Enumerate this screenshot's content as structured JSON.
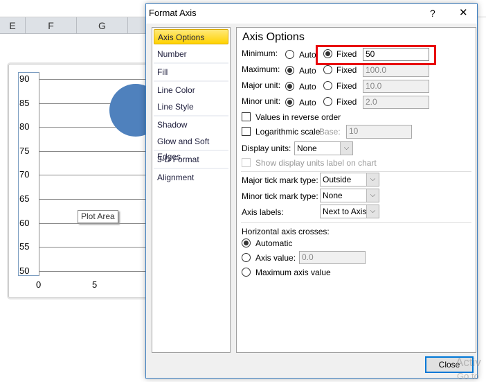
{
  "spreadsheet": {
    "columns": [
      "E",
      "F",
      "G"
    ]
  },
  "chart": {
    "y_ticks": [
      "90",
      "85",
      "80",
      "75",
      "70",
      "65",
      "60",
      "55",
      "50"
    ],
    "x_ticks": [
      "0",
      "5"
    ],
    "tooltip": "Plot Area",
    "bubble_color": "#4f81bd"
  },
  "dialog": {
    "title": "Format Axis",
    "help": "?",
    "close_x": "✕",
    "nav": [
      "Axis Options",
      "Number",
      "Fill",
      "Line Color",
      "Line Style",
      "Shadow",
      "Glow and Soft Edges",
      "3-D Format",
      "Alignment"
    ],
    "panel_title": "Axis Options",
    "rows": [
      {
        "label": "Minimum:",
        "auto": "Auto",
        "fixed": "Fixed",
        "value": "50",
        "selected": "fixed"
      },
      {
        "label": "Maximum:",
        "auto": "Auto",
        "fixed": "Fixed",
        "value": "100.0",
        "selected": "auto"
      },
      {
        "label": "Major unit:",
        "auto": "Auto",
        "fixed": "Fixed",
        "value": "10.0",
        "selected": "auto"
      },
      {
        "label": "Minor unit:",
        "auto": "Auto",
        "fixed": "Fixed",
        "value": "2.0",
        "selected": "auto"
      }
    ],
    "reverse": "Values in reverse order",
    "log": "Logarithmic scale",
    "base_label": "Base:",
    "base_value": "10",
    "display_units_label": "Display units:",
    "display_units": "None",
    "show_units_label": "Show display units label on chart",
    "major_tick_label": "Major tick mark type:",
    "major_tick": "Outside",
    "minor_tick_label": "Minor tick mark type:",
    "minor_tick": "None",
    "axis_labels_label": "Axis labels:",
    "axis_labels": "Next to Axis",
    "crosses_label": "Horizontal axis crosses:",
    "cross_auto": "Automatic",
    "cross_value": "Axis value:",
    "cross_value_input": "0.0",
    "cross_max": "Maximum axis value",
    "close_button": "Close",
    "highlight_color": "#e8000b"
  },
  "watermark": [
    "Activ",
    "Go to"
  ]
}
